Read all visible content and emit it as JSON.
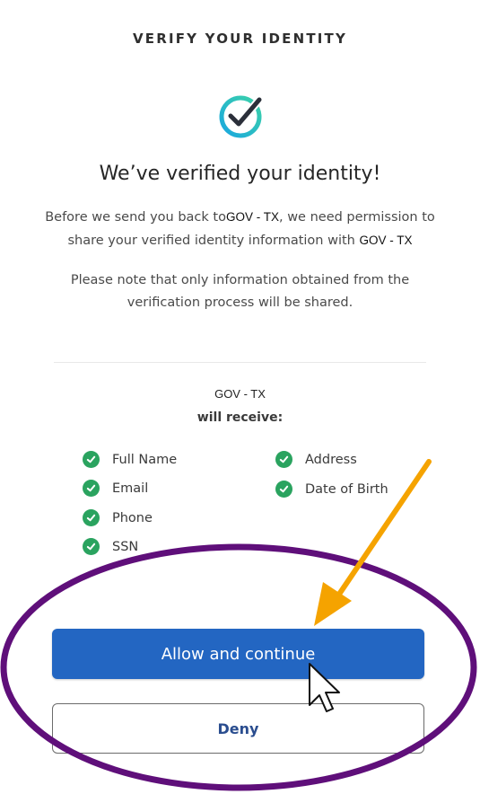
{
  "header": {
    "title": "VERIFY YOUR IDENTITY"
  },
  "icons": {
    "verified": "check-circle-icon",
    "attribute_check": "check-icon",
    "cursor": "mouse-pointer-icon",
    "arrow": "arrow-annotation"
  },
  "main": {
    "headline": "We’ve verified your identity!",
    "para1_a": "Before we send you back to",
    "para1_gov": "GOV - TX",
    "para1_b": ", we need permission to",
    "para1_c": "share your verified identity information with",
    "para1_gov2": "GOV - TX",
    "para2_line1": "Please note that only information obtained from the",
    "para2_line2": "verification process will be shared.",
    "recipient": "GOV - TX",
    "receive_label": "will receive:",
    "attributes_left": [
      "Full Name",
      "Email",
      "Phone",
      "SSN"
    ],
    "attributes_right": [
      "Address",
      "Date of Birth"
    ]
  },
  "buttons": {
    "allow": "Allow and continue",
    "deny": "Deny"
  },
  "colors": {
    "primary": "#2366c2",
    "check_green": "#2aa35f",
    "icon_teal": "#2bb7c9",
    "annotation_ellipse": "#5f0f7a",
    "annotation_arrow": "#f5a300",
    "deny_text": "#2a4d8f"
  }
}
